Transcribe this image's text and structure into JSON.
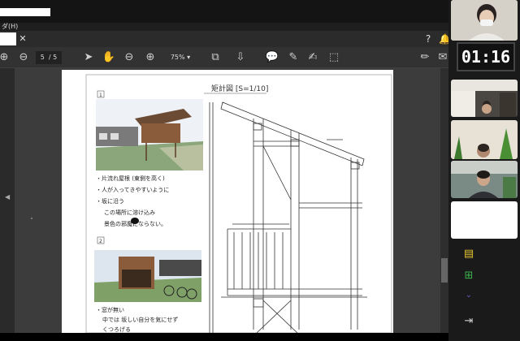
{
  "app": {
    "menu_text": "ダ(H)",
    "page_current": "5",
    "page_sep": "/ 5",
    "zoom": "75%"
  },
  "toolbar_icons": [
    "home-icon",
    "page-up-icon",
    "page-down-icon",
    "select-icon",
    "hand-icon",
    "zoom-out-icon",
    "zoom-in-icon",
    "fit-page-icon",
    "scroll-mode-icon",
    "comment-icon",
    "highlight-icon",
    "sign-icon",
    "stamp-icon",
    "edit-icon",
    "mail-icon"
  ],
  "document": {
    "title": "矩計図 [S=1/10]",
    "section1_num": "1",
    "section2_num": "2",
    "notes1": [
      "・片流れ屋根 (東側を高く)",
      "・人が入ってきやすいように",
      "・坂に沿う",
      "この場所に溶け込み",
      "景色の邪魔にならない。"
    ],
    "notes2": [
      "・窓が無い",
      "中では 坂しい自分を気にせず",
      "くつろげる"
    ]
  },
  "meeting": {
    "timer": "01:16"
  },
  "colors": {
    "accent_yellow": "#e5c431",
    "accent_green": "#3bb24c",
    "accent_purple": "#6d58c4"
  }
}
